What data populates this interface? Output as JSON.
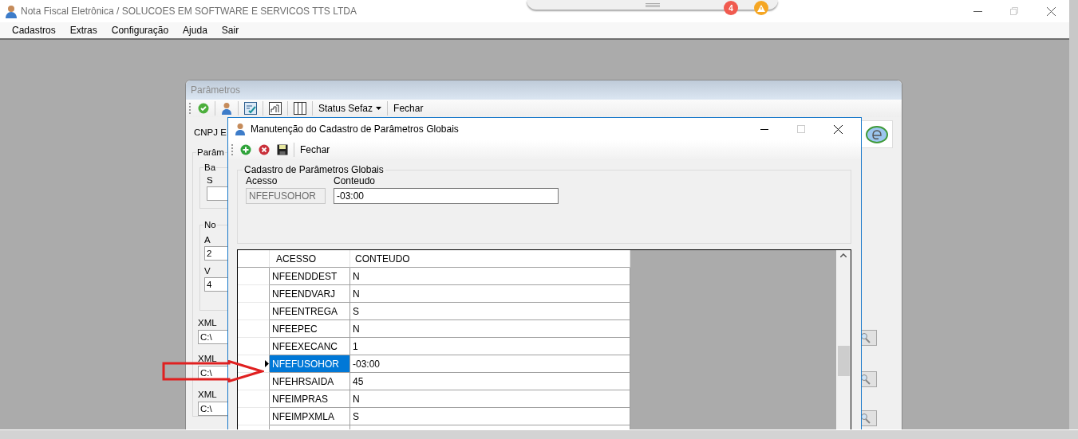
{
  "app": {
    "title": "Nota Fiscal Eletrônica / SOLUCOES EM SOFTWARE E SERVICOS TTS LTDA"
  },
  "notifications": {
    "count": "4"
  },
  "menu": [
    "Cadastros",
    "Extras",
    "Configuração",
    "Ajuda",
    "Sair"
  ],
  "parametros_window": {
    "title": "Parâmetros",
    "toolbar": [
      {
        "kind": "check"
      },
      {
        "kind": "user"
      },
      {
        "kind": "checklist"
      },
      {
        "kind": "chart"
      },
      {
        "kind": "columns"
      },
      {
        "kind": "dropdown",
        "label": "Status Sefaz"
      },
      {
        "kind": "text",
        "label": "Fechar"
      }
    ],
    "cnpj_label": "CNPJ E",
    "group_label": "Parâm",
    "subgroup_1": {
      "label": "Ba",
      "field_label": "S"
    },
    "subgroup_2": {
      "label": "No",
      "fields": [
        {
          "label": "A",
          "value": "2"
        },
        {
          "label": "V",
          "value": "4"
        }
      ]
    },
    "xml_fields": [
      {
        "label": "XML",
        "value": "C:\\"
      },
      {
        "label": "XML",
        "value": "C:\\"
      },
      {
        "label": "XML",
        "value": "C:\\"
      }
    ]
  },
  "dialog": {
    "title": "Manutenção do Cadastro de Parâmetros Globais",
    "toolbar": [
      {
        "kind": "add"
      },
      {
        "kind": "cancel"
      },
      {
        "kind": "save"
      },
      {
        "kind": "text",
        "label": "Fechar"
      }
    ],
    "group": {
      "title": "Cadastro de Parâmetros Globais",
      "acesso": {
        "label": "Acesso",
        "value": "NFEFUSOHOR",
        "disabled": true
      },
      "conteudo": {
        "label": "Conteudo",
        "value": "-03:00",
        "disabled": false
      }
    },
    "table": {
      "columns": [
        "ACESSO",
        "CONTEUDO"
      ],
      "rows": [
        {
          "acesso": "NFEENDDEST",
          "conteudo": "N",
          "selected": false
        },
        {
          "acesso": "NFEENDVARJ",
          "conteudo": "N",
          "selected": false
        },
        {
          "acesso": "NFEENTREGA",
          "conteudo": "S",
          "selected": false
        },
        {
          "acesso": "NFEEPEC",
          "conteudo": "N",
          "selected": false
        },
        {
          "acesso": "NFEEXECANC",
          "conteudo": "1",
          "selected": false
        },
        {
          "acesso": "NFEFUSOHOR",
          "conteudo": "-03:00",
          "selected": true
        },
        {
          "acesso": "NFEHRSAIDA",
          "conteudo": "45",
          "selected": false
        },
        {
          "acesso": "NFEIMPRAS",
          "conteudo": "N",
          "selected": false
        },
        {
          "acesso": "NFEIMPXMLA",
          "conteudo": "S",
          "selected": false
        }
      ]
    }
  }
}
